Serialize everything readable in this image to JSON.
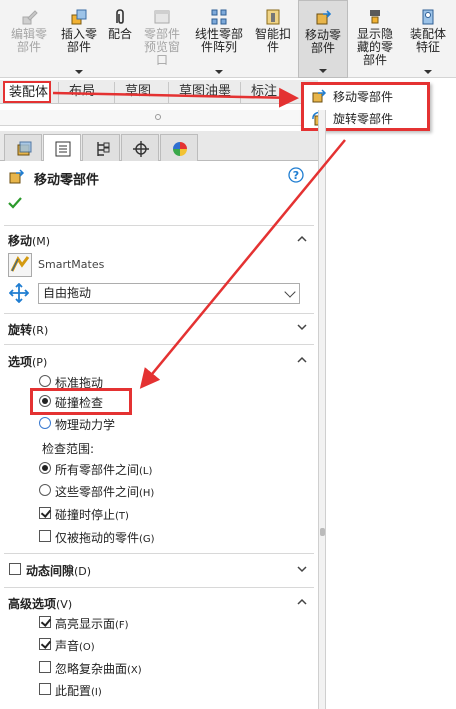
{
  "toolbar": {
    "buttons": [
      {
        "label": "编辑零部件",
        "line1": "编辑零",
        "line2": "部件",
        "state": "disabled",
        "icon": "edit-component-icon"
      },
      {
        "label": "插入零部件",
        "line1": "插入零",
        "line2": "部件",
        "state": "enabled",
        "icon": "insert-component-icon"
      },
      {
        "label": "配合",
        "line1": "配合",
        "line2": "",
        "state": "enabled",
        "icon": "mate-paperclip-icon"
      },
      {
        "label": "零部件预览窗口",
        "line1": "零部件",
        "line2": "预览窗",
        "line3": "口",
        "state": "disabled",
        "icon": "preview-window-icon"
      },
      {
        "label": "线性零部件阵列",
        "line1": "线性零部",
        "line2": "件阵列",
        "state": "enabled",
        "icon": "linear-pattern-icon"
      },
      {
        "label": "智能扣件",
        "line1": "智能扣",
        "line2": "件",
        "state": "enabled",
        "icon": "smart-fastener-icon"
      },
      {
        "label": "移动零部件",
        "line1": "移动零",
        "line2": "部件",
        "state": "pressed",
        "icon": "move-component-icon"
      },
      {
        "label": "显示隐藏的零部件",
        "line1": "显示隐",
        "line2": "藏的零",
        "line3": "部件",
        "state": "enabled",
        "icon": "show-hidden-icon"
      },
      {
        "label": "装配体特征",
        "line1": "装配体",
        "line2": "特征",
        "state": "enabled",
        "icon": "assembly-feature-icon"
      }
    ]
  },
  "tabs": [
    "装配体",
    "布局",
    "草图",
    "草图油墨",
    "标注"
  ],
  "dropdown": {
    "items": [
      {
        "label": "移动零部件",
        "icon": "move-component-icon"
      },
      {
        "label": "旋转零部件",
        "icon": "rotate-component-icon"
      }
    ]
  },
  "panel": {
    "title": "移动零部件",
    "help_icon": "help-icon",
    "ok_icon": "checkmark-icon",
    "move": {
      "title": "移动",
      "hotkey": "(M)",
      "smartmates": "SmartMates",
      "drag_mode": "自由拖动"
    },
    "rotate": {
      "title": "旋转",
      "hotkey": "(R)"
    },
    "options": {
      "title": "选项",
      "hotkey": "(P)",
      "radios": [
        "标准拖动",
        "碰撞检查",
        "物理动力学"
      ],
      "selected": "碰撞检查",
      "check_range_label": "检查范围:",
      "range_radios": [
        {
          "label": "所有零部件之间",
          "hotkey": "(L)",
          "selected": true
        },
        {
          "label": "这些零部件之间",
          "hotkey": "(H)",
          "selected": false
        }
      ],
      "checkboxes": [
        {
          "label": "碰撞时停止",
          "hotkey": "(T)",
          "checked": true
        },
        {
          "label": "仅被拖动的零件",
          "hotkey": "(G)",
          "checked": false
        }
      ]
    },
    "dynamic_clearance": {
      "title": "动态间隙",
      "hotkey": "(D)",
      "checked": false
    },
    "advanced": {
      "title": "高级选项",
      "hotkey": "(V)",
      "checkboxes": [
        {
          "label": "高亮显示面",
          "hotkey": "(F)",
          "checked": true
        },
        {
          "label": "声音",
          "hotkey": "(O)",
          "checked": true
        },
        {
          "label": "忽略复杂曲面",
          "hotkey": "(X)",
          "checked": false
        },
        {
          "label": "此配置",
          "hotkey": "(I)",
          "checked": false
        }
      ]
    }
  },
  "colors": {
    "highlight": "#e43232",
    "accent": "#1f7dd1"
  }
}
